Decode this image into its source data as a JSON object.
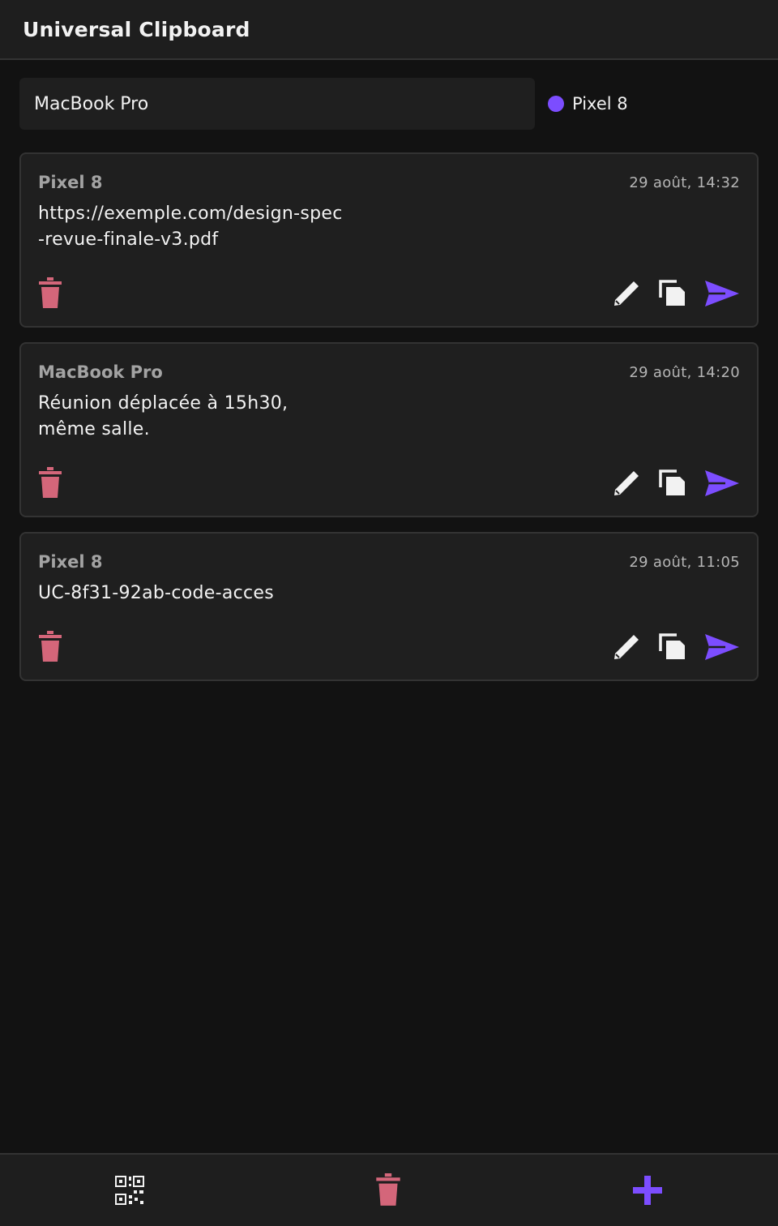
{
  "header": {
    "title": "Universal Clipboard"
  },
  "device": {
    "name_value": "MacBook Pro"
  },
  "peer": {
    "name": "Pixel 8",
    "status_color": "#7c4dff"
  },
  "clips": [
    {
      "source": "Pixel 8",
      "time": "29 août, 14:32",
      "content": "https://exemple.com/design-spec\n-revue-finale-v3.pdf"
    },
    {
      "source": "MacBook Pro",
      "time": "29 août, 14:20",
      "content": "Réunion déplacée à 15h30,\nmême salle."
    },
    {
      "source": "Pixel 8",
      "time": "29 août, 11:05",
      "content": "UC-8f31-92ab-code-acces"
    }
  ],
  "icons": {
    "delete": "trash-icon",
    "edit": "pencil-icon",
    "copy": "copy-icon",
    "send": "send-icon",
    "qr": "qr-code-icon",
    "clear_all": "trash-icon",
    "add": "plus-icon"
  },
  "colors": {
    "accent": "#7c4dff",
    "danger": "#d4667a",
    "background": "#121212",
    "surface": "#1f1f1f"
  }
}
